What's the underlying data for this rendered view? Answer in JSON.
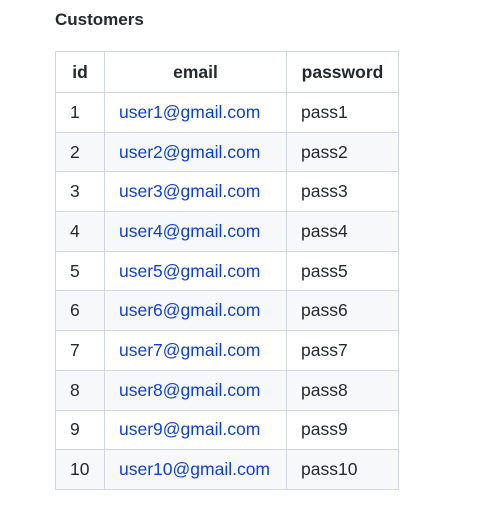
{
  "page": {
    "title": "Customers"
  },
  "table": {
    "columns": [
      "id",
      "email",
      "password"
    ],
    "rows": [
      {
        "id": "1",
        "email": "user1@gmail.com",
        "password": "pass1"
      },
      {
        "id": "2",
        "email": "user2@gmail.com",
        "password": "pass2"
      },
      {
        "id": "3",
        "email": "user3@gmail.com",
        "password": "pass3"
      },
      {
        "id": "4",
        "email": "user4@gmail.com",
        "password": "pass4"
      },
      {
        "id": "5",
        "email": "user5@gmail.com",
        "password": "pass5"
      },
      {
        "id": "6",
        "email": "user6@gmail.com",
        "password": "pass6"
      },
      {
        "id": "7",
        "email": "user7@gmail.com",
        "password": "pass7"
      },
      {
        "id": "8",
        "email": "user8@gmail.com",
        "password": "pass8"
      },
      {
        "id": "9",
        "email": "user9@gmail.com",
        "password": "pass9"
      },
      {
        "id": "10",
        "email": "user10@gmail.com",
        "password": "pass10"
      }
    ]
  },
  "colors": {
    "text": "#24292f",
    "link": "#0f3fd6",
    "border": "#d0d7de",
    "stripe": "#f6f8fa"
  }
}
